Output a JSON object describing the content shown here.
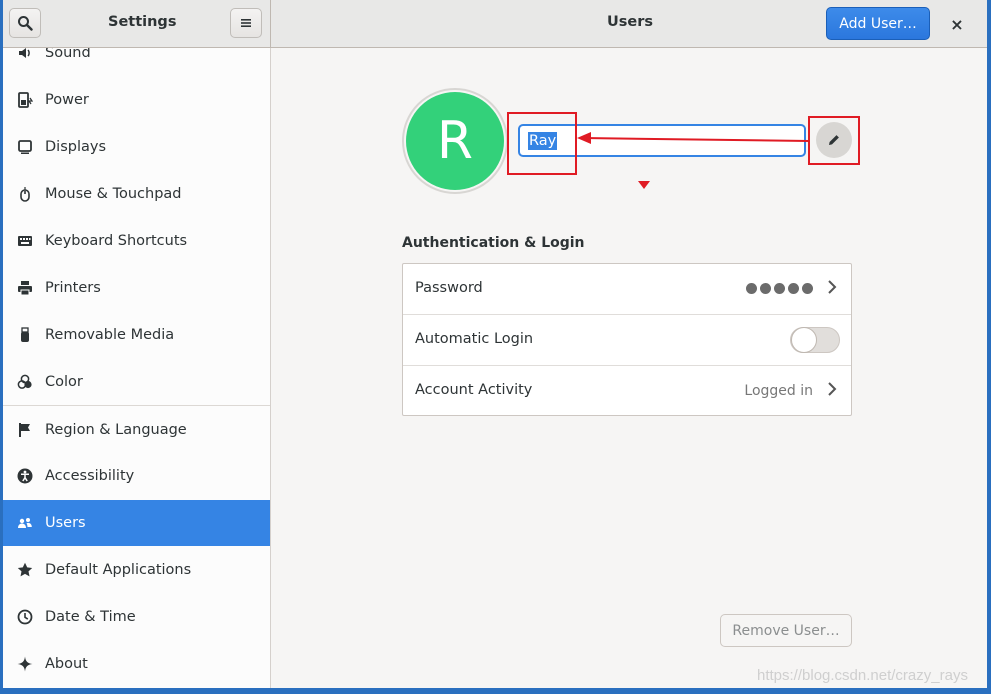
{
  "header": {
    "sidebar_title": "Settings",
    "main_title": "Users",
    "add_user_label": "Add User…",
    "close_label": "×"
  },
  "sidebar": {
    "items": [
      {
        "label": "Sound",
        "icon": "speaker-icon"
      },
      {
        "label": "Power",
        "icon": "power-icon"
      },
      {
        "label": "Displays",
        "icon": "display-icon"
      },
      {
        "label": "Mouse & Touchpad",
        "icon": "mouse-icon"
      },
      {
        "label": "Keyboard Shortcuts",
        "icon": "keyboard-icon"
      },
      {
        "label": "Printers",
        "icon": "printer-icon"
      },
      {
        "label": "Removable Media",
        "icon": "usb-icon"
      },
      {
        "label": "Color",
        "icon": "color-icon"
      },
      {
        "label": "Region & Language",
        "icon": "flag-icon"
      },
      {
        "label": "Accessibility",
        "icon": "accessibility-icon"
      },
      {
        "label": "Users",
        "icon": "users-icon",
        "active": true
      },
      {
        "label": "Default Applications",
        "icon": "star-icon"
      },
      {
        "label": "Date & Time",
        "icon": "clock-icon"
      },
      {
        "label": "About",
        "icon": "sparkle-icon"
      }
    ]
  },
  "user": {
    "avatar_initial": "R",
    "name_value": "Ray"
  },
  "auth": {
    "section_title": "Authentication & Login",
    "password_label": "Password",
    "auto_login_label": "Automatic Login",
    "auto_login_enabled": false,
    "account_activity_label": "Account Activity",
    "account_activity_value": "Logged in"
  },
  "remove_user_label": "Remove User…",
  "watermark": "https://blog.csdn.net/crazy_rays",
  "colors": {
    "accent": "#3584e4",
    "avatar_bg": "#33d17a",
    "annotation_red": "#e01b24"
  }
}
